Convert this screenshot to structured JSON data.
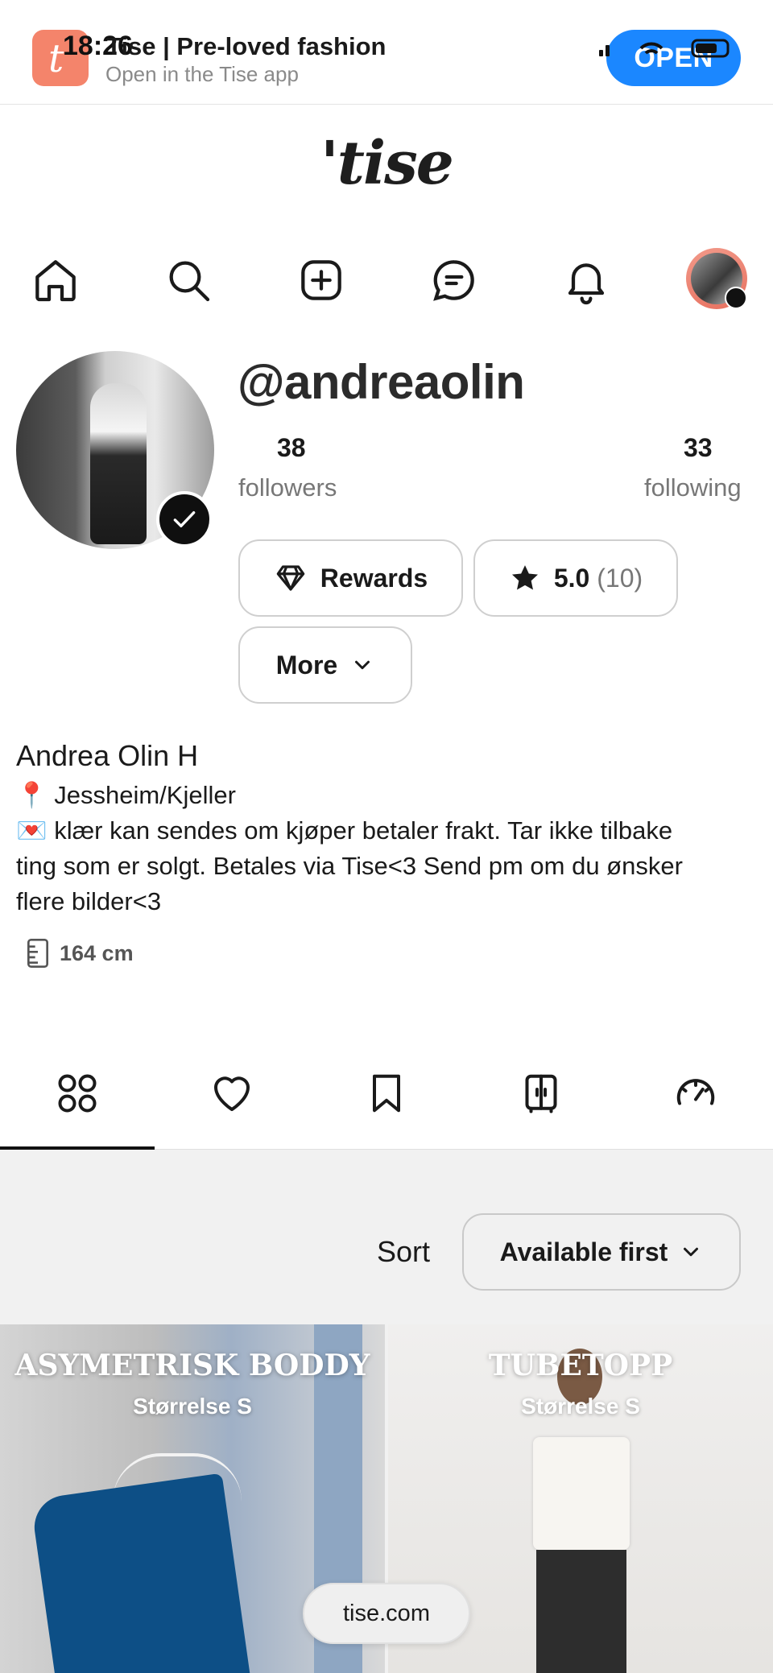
{
  "status_bar": {
    "time": "18:26"
  },
  "banner": {
    "title": "Tise | Pre-loved fashion",
    "subtitle": "Open in the Tise app",
    "open_label": "OPEN"
  },
  "brand": {
    "logo_text": "'tise"
  },
  "nav": {
    "items": [
      {
        "icon": "home-icon"
      },
      {
        "icon": "search-icon"
      },
      {
        "icon": "add-icon"
      },
      {
        "icon": "chat-icon"
      },
      {
        "icon": "bell-icon"
      },
      {
        "icon": "avatar"
      }
    ]
  },
  "profile": {
    "handle": "@andreaolin",
    "followers_count": "38",
    "followers_label": "followers",
    "following_count": "33",
    "following_label": "following",
    "rewards_label": "Rewards",
    "rating_value": "5.0",
    "rating_count": "(10)",
    "more_label": "More",
    "full_name": "Andrea Olin H",
    "location": "Jessheim/Kjeller",
    "bio_line1": "klær kan sendes om kjøper betaler frakt. Tar ikke tilbake",
    "bio_line2": "ting som er solgt. Betales via Tise<3 Send pm om du ønsker",
    "bio_line3": "flere bilder<3",
    "height": "164 cm"
  },
  "tabs": [
    {
      "icon": "grid-icon",
      "active": true
    },
    {
      "icon": "heart-icon"
    },
    {
      "icon": "bookmark-icon"
    },
    {
      "icon": "wardrobe-icon"
    },
    {
      "icon": "gauge-icon"
    }
  ],
  "listing": {
    "sort_label": "Sort",
    "sort_value": "Available first",
    "items": [
      {
        "title": "ASYMETRISK BODDY",
        "size": "Størrelse S"
      },
      {
        "title": "TUBETOPP",
        "size": "Størrelse S"
      }
    ]
  },
  "footer": {
    "domain": "tise.com"
  },
  "colors": {
    "accent": "#1b87ff",
    "brand_coral": "#f4846b",
    "text": "#1a1a1a",
    "muted": "#777777"
  }
}
